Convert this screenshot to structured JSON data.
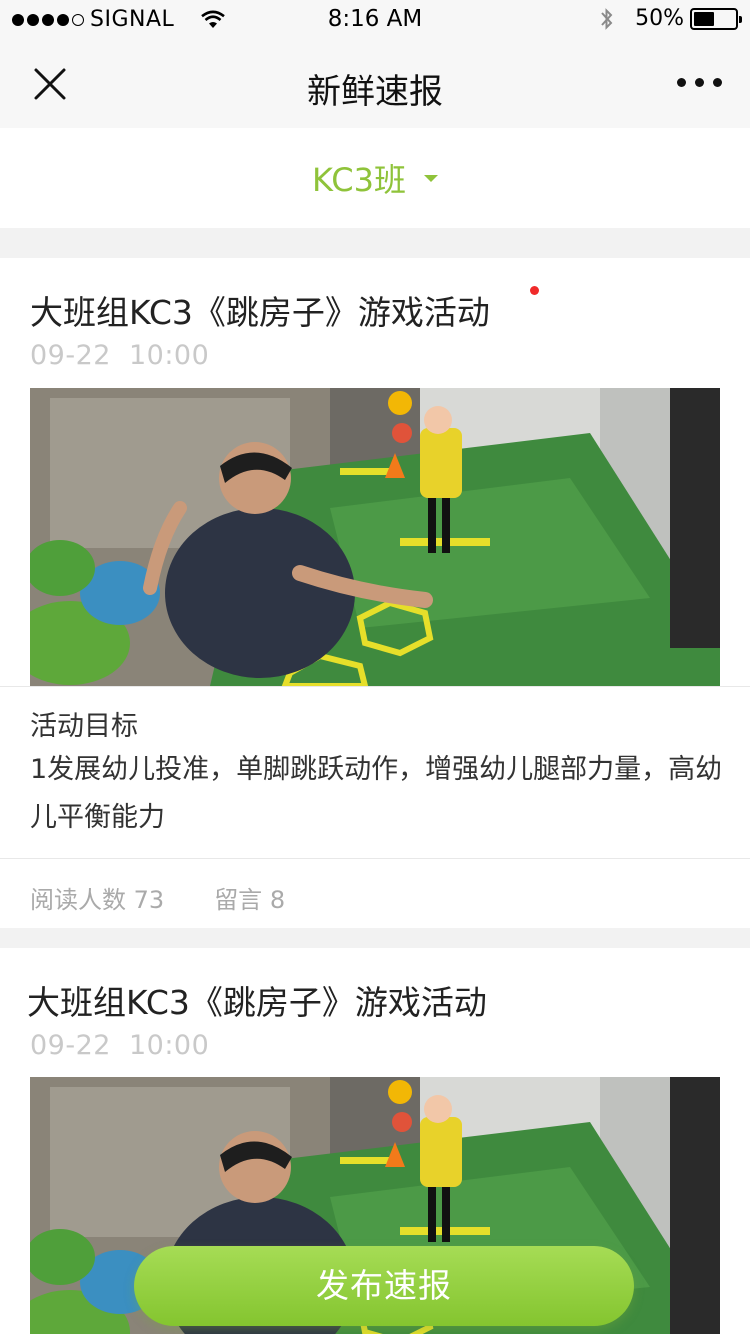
{
  "status_bar": {
    "carrier": "SIGNAL",
    "time": "8:16 AM",
    "battery": "50%",
    "battery_level": 0.5
  },
  "nav": {
    "title": "新鲜速报",
    "close_icon": "close-icon",
    "more_icon": "more-icon"
  },
  "class_filter": {
    "label": "KC3班",
    "accent": "#8fc33a"
  },
  "posts": [
    {
      "title": "大班组KC3《跳房子》游戏活动",
      "unread": true,
      "date": "09-22",
      "time": "10:00",
      "goal_title": "活动目标",
      "goal_text": "1发展幼儿投准，单脚跳跃动作，增强幼儿腿部力量，高幼儿平衡能力",
      "reads_label": "阅读人数",
      "reads": "73",
      "comments_label": "留言",
      "comments": "8"
    },
    {
      "title": "大班组KC3《跳房子》游戏活动",
      "unread": false,
      "date": "09-22",
      "time": "10:00"
    }
  ],
  "publish_button": {
    "label": "发布速报"
  }
}
